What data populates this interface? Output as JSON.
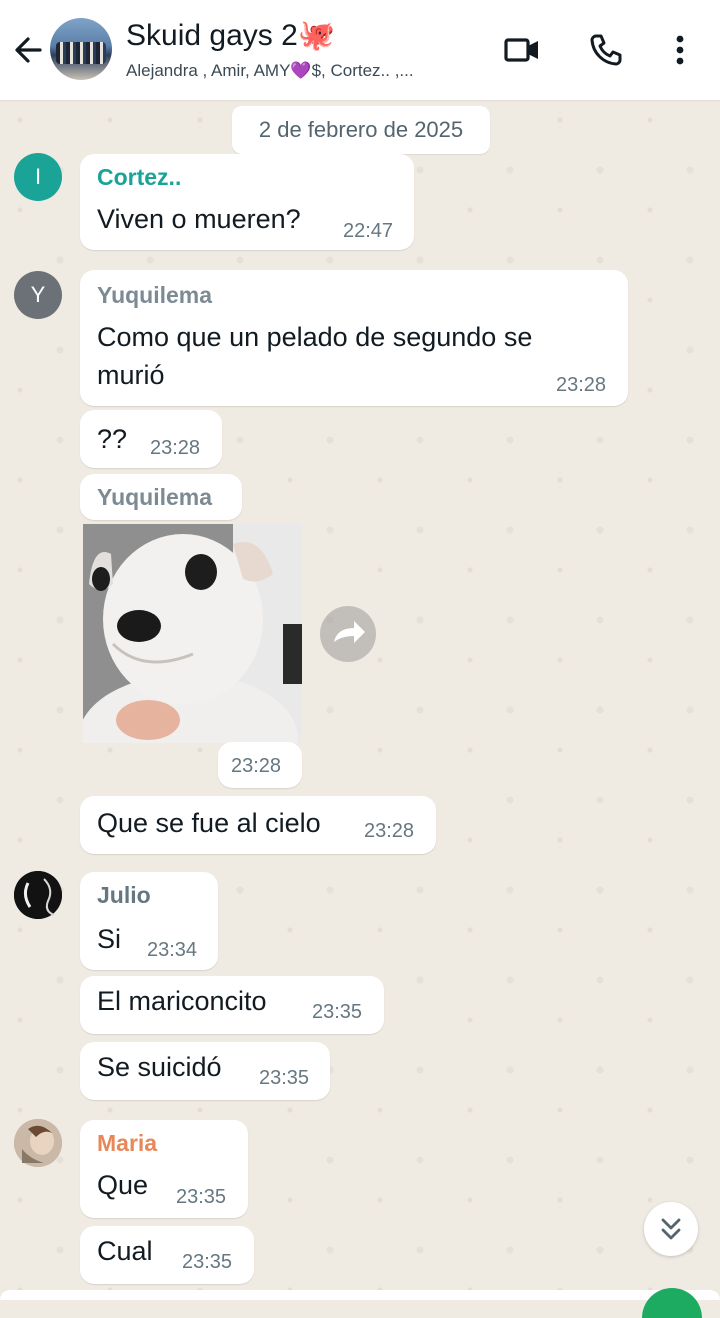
{
  "header": {
    "title": "Skuid gays 2🐙",
    "members": "Alejandra , Amir, AMY💜$, Cortez.. ,..."
  },
  "chat": {
    "date_divider": "2 de febrero de 2025",
    "messages": [
      {
        "sender": "Cortez..",
        "avatar_letter": "I",
        "text": "Viven o mueren?",
        "time": "22:47"
      },
      {
        "sender": "Yuquilema",
        "avatar_letter": "Y",
        "text": "Como que un pelado de segundo se murió",
        "time": "23:28"
      },
      {
        "text": "??",
        "time": "23:28"
      },
      {
        "sender": "Yuquilema",
        "image": "puppy-sticker",
        "time": "23:28"
      },
      {
        "text": "Que se fue al cielo",
        "time": "23:28"
      },
      {
        "sender": "Julio",
        "text": "Si",
        "time": "23:34"
      },
      {
        "text": "El mariconcito",
        "time": "23:35"
      },
      {
        "text": "Se suicidó",
        "time": "23:35"
      },
      {
        "sender": "Maria",
        "text": "Que",
        "time": "23:35"
      },
      {
        "text": "Cual",
        "time": "23:35"
      }
    ]
  },
  "colors": {
    "cortez_name": "#1aa397",
    "yuquilema_name": "#7c8a93",
    "julio_name": "#667781",
    "maria_name": "#e8875a",
    "accent_green": "#1daa61",
    "wallpaper": "#efeae2"
  },
  "icons": [
    "back-arrow-icon",
    "video-call-icon",
    "phone-icon",
    "more-vertical-icon",
    "forward-icon",
    "scroll-down-icon"
  ]
}
